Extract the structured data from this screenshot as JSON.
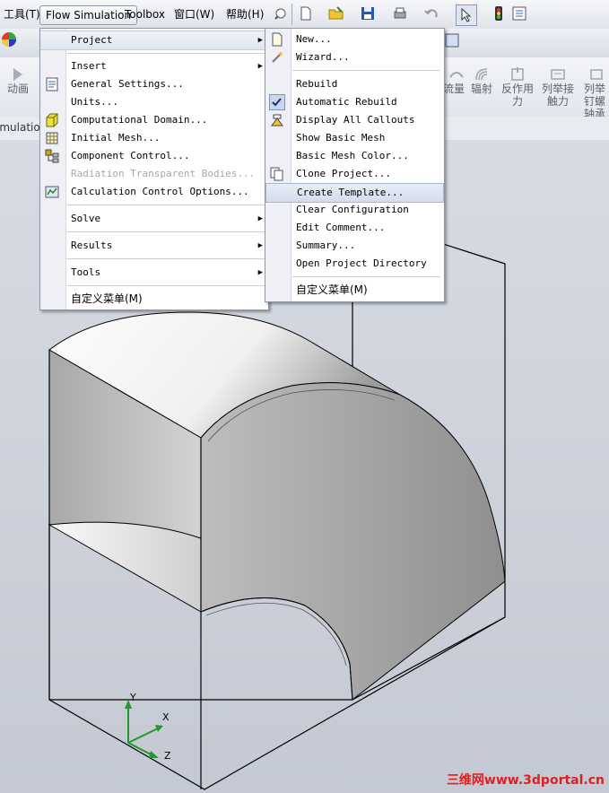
{
  "menubar": {
    "items": [
      {
        "label": "工具(T)"
      },
      {
        "label": "Flow Simulation"
      },
      {
        "label": "Toolbox"
      },
      {
        "label": "窗口(W)"
      },
      {
        "label": "帮助(H)"
      }
    ]
  },
  "ribbon": {
    "left_label": "动画",
    "right_labels": [
      "流量",
      "辐射",
      "反作用力",
      "列举接触力",
      "列举钉螺轴承"
    ],
    "tab_label": "imulatio"
  },
  "flow_menu": {
    "items": [
      {
        "label": "Project",
        "submenu": true
      },
      {
        "label": "Insert",
        "submenu": true
      },
      {
        "label": "General Settings..."
      },
      {
        "label": "Units..."
      },
      {
        "label": "Computational Domain..."
      },
      {
        "label": "Initial Mesh..."
      },
      {
        "label": "Component Control..."
      },
      {
        "label": "Radiation Transparent Bodies...",
        "disabled": true
      },
      {
        "label": "Calculation Control Options..."
      },
      {
        "label": "Solve",
        "submenu": true
      },
      {
        "label": "Results",
        "submenu": true
      },
      {
        "label": "Tools",
        "submenu": true
      },
      {
        "label": "自定义菜单(M)"
      }
    ]
  },
  "project_menu": {
    "items": [
      {
        "label": "New..."
      },
      {
        "label": "Wizard..."
      },
      {
        "label": "Rebuild"
      },
      {
        "label": "Automatic Rebuild",
        "checked": true
      },
      {
        "label": "Display All Callouts"
      },
      {
        "label": "Show Basic Mesh"
      },
      {
        "label": "Basic Mesh Color..."
      },
      {
        "label": "Clone Project..."
      },
      {
        "label": "Create Template..."
      },
      {
        "label": "Clear Configuration"
      },
      {
        "label": "Edit Comment..."
      },
      {
        "label": "Summary..."
      },
      {
        "label": "Open Project Directory"
      },
      {
        "label": "自定义菜单(M)"
      }
    ]
  },
  "axes": {
    "x": "X",
    "y": "Y",
    "z": "Z"
  },
  "watermark": "三维网www.3dportal.cn",
  "colors": {
    "axis_green": "#1f9a2a",
    "menu_highlight": "#dfe6f0",
    "watermark": "#e02020"
  }
}
